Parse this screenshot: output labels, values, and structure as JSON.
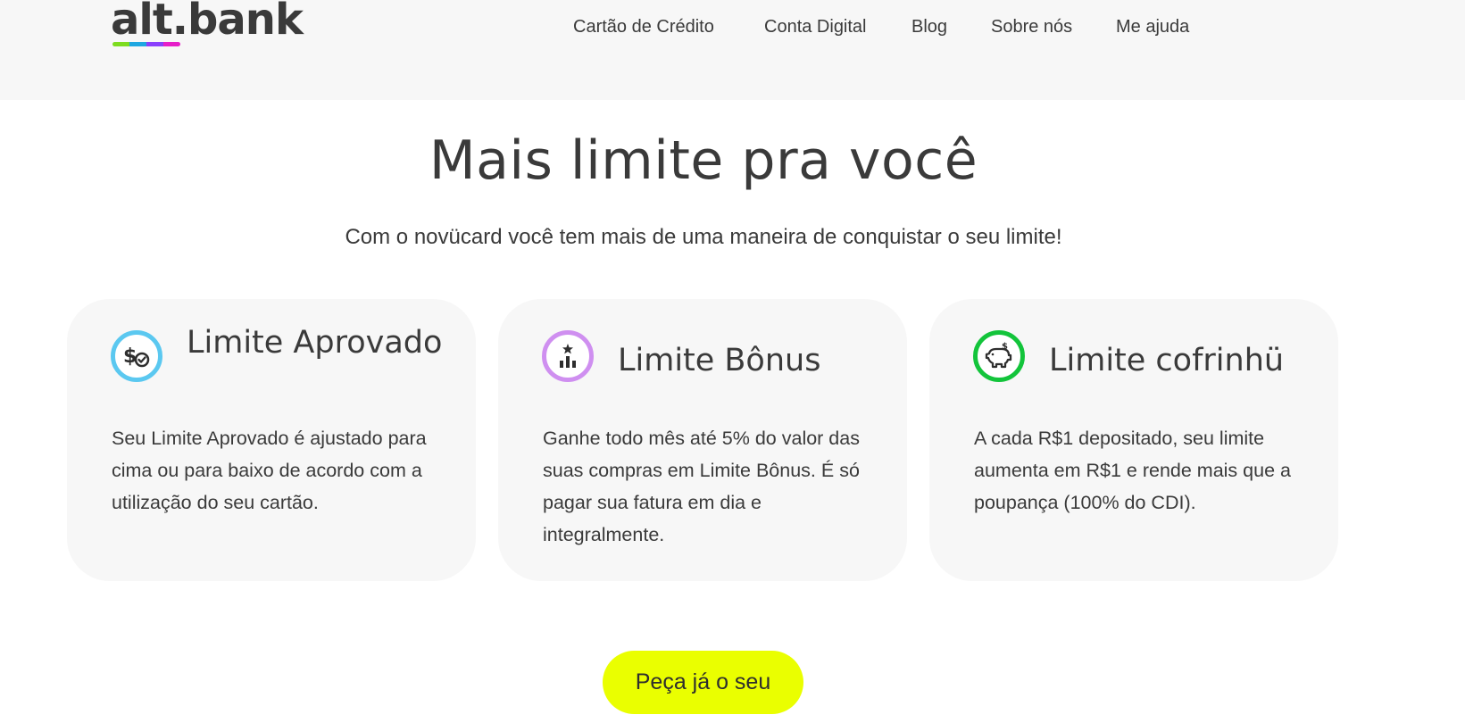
{
  "header": {
    "logo_text": "alt.bank",
    "logo_colors": [
      "#7ddc1f",
      "#1ea7e1",
      "#8a3ffc",
      "#e61ec8"
    ],
    "nav": [
      {
        "label": "Cartão de Crédito"
      },
      {
        "label": "Conta Digital"
      },
      {
        "label": "Blog"
      },
      {
        "label": "Sobre nós"
      },
      {
        "label": "Me ajuda"
      }
    ]
  },
  "hero": {
    "title": "Mais limite pra você",
    "subtitle": "Com o novücard você tem mais de uma maneira de conquistar o seu limite!"
  },
  "cards": [
    {
      "title": "Limite Aprovado",
      "text": "Seu Limite Aprovado é ajustado para cima ou para baixo de acordo com a utilização do seu cartão.",
      "icon": "dollar-check-icon",
      "accent": "#5bc8f0"
    },
    {
      "title": "Limite Bônus",
      "text": "Ganhe todo mês até 5% do valor das suas compras em Limite Bônus. É só pagar sua fatura em dia e integralmente.",
      "icon": "bar-chart-star-icon",
      "accent": "#cf8ff0"
    },
    {
      "title": "Limite cofrinhü",
      "text": "A cada R$1 depositado, seu limite aumenta em R$1 e rende mais que a poupança (100% do CDI).",
      "icon": "piggy-bank-icon",
      "accent": "#13c43b"
    }
  ],
  "cta": {
    "label": "Peça já o seu",
    "color": "#eaff00"
  }
}
